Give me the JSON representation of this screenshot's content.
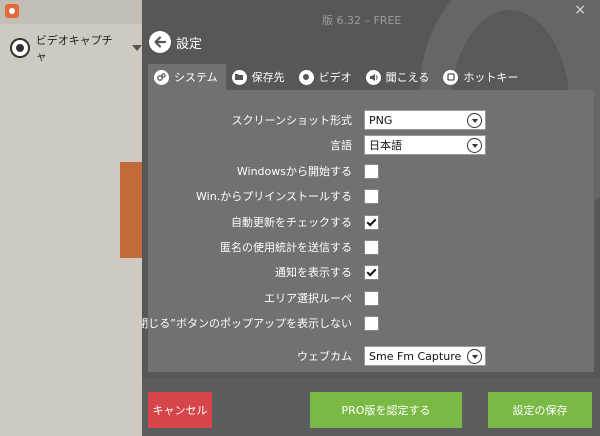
{
  "app": {
    "mode_label": "ビデオキャプチャ",
    "title": "版 6.32 – FREE",
    "close_glyph": "×"
  },
  "header": {
    "back_label": "設定"
  },
  "tabs": [
    {
      "label": "システム",
      "icon": "system-icon",
      "active": true
    },
    {
      "label": "保存先",
      "icon": "folder-icon",
      "active": false
    },
    {
      "label": "ビデオ",
      "icon": "record-icon",
      "active": false
    },
    {
      "label": "聞こえる",
      "icon": "speaker-icon",
      "active": false
    },
    {
      "label": "ホットキー",
      "icon": "hotkey-icon",
      "active": false
    }
  ],
  "settings": {
    "screenshot_format": {
      "label": "スクリーンショット形式",
      "value": "PNG"
    },
    "language": {
      "label": "言語",
      "value": "日本語"
    },
    "start_with_windows": {
      "label": "Windowsから開始する",
      "checked": false
    },
    "preinstall": {
      "label": "Win.からプリインストールする",
      "checked": false
    },
    "auto_update": {
      "label": "自動更新をチェックする",
      "checked": true
    },
    "anonymous_stats": {
      "label": "匿名の使用統計を送信する",
      "checked": false
    },
    "show_notifications": {
      "label": "通知を表示する",
      "checked": true
    },
    "area_magnifier": {
      "label": "エリア選択ルーペ",
      "checked": false
    },
    "close_popup": {
      "label": "“閉じる”ボタンのポップアップを表示しない",
      "checked": false
    },
    "webcam": {
      "label": "ウェブカム",
      "value": "Sme Fm Capture"
    }
  },
  "footer": {
    "cancel_label": "キャンセル",
    "activate_label": "PRO版を認定する",
    "save_label": "設定の保存"
  },
  "colors": {
    "panel_bg": "#555759",
    "content_bg": "#6f7173",
    "cancel": "#d6454a",
    "accent_green": "#7ab944",
    "brand_orange": "#e26a3a"
  }
}
